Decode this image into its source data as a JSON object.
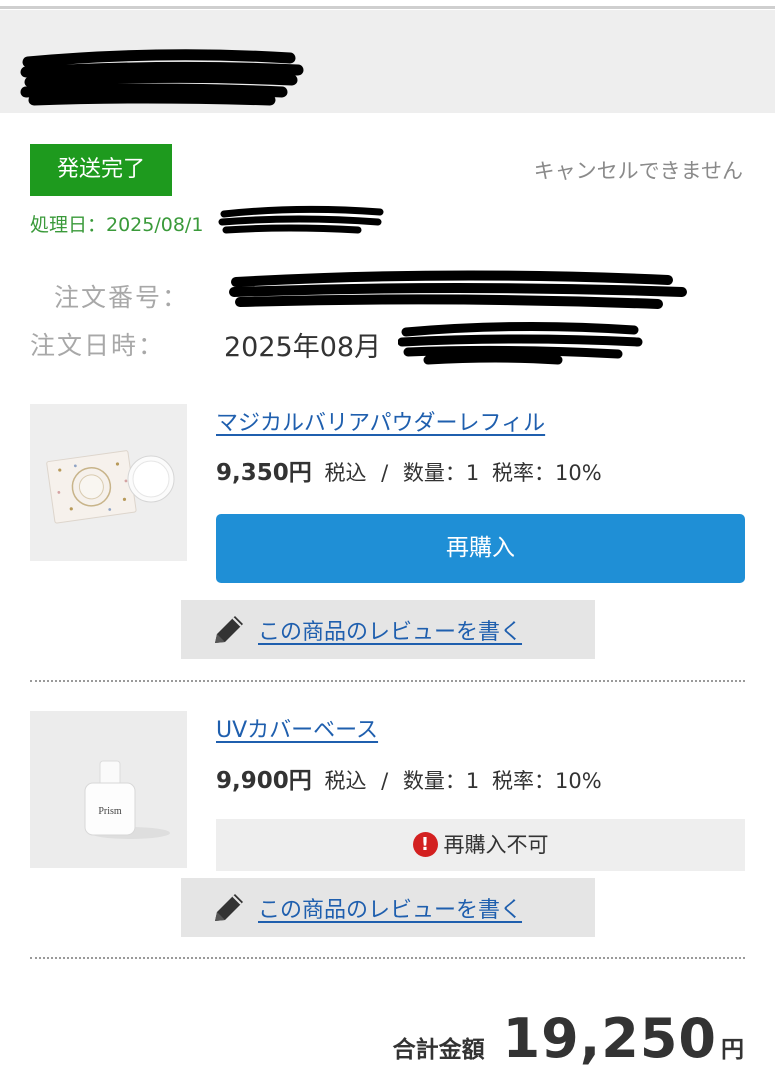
{
  "colors": {
    "status_green": "#1e9a1e",
    "link_blue": "#1f5fae",
    "primary_button": "#1f8fd6",
    "alert_red": "#d32020"
  },
  "order": {
    "status": "発送完了",
    "cancel_note": "キャンセルできません",
    "processed_prefix": "処理日：2025/08/1",
    "order_number_label": "注文番号：",
    "order_date_label": "注文日時：",
    "order_date_prefix": "2025年08月"
  },
  "items": [
    {
      "name": "マジカルバリアパウダーレフィル",
      "price": "9,350円",
      "tax_label": "税込",
      "separator": "/",
      "quantity": "数量：1",
      "tax_rate": "税率：10%",
      "image_icon": "powder-compact-photo",
      "action": "再購入",
      "review": "この商品のレビューを書く"
    },
    {
      "name": "UVカバーベース",
      "price": "9,900円",
      "tax_label": "税込",
      "separator": "/",
      "quantity": "数量：1",
      "tax_rate": "税率：10%",
      "image_icon": "bottle-photo",
      "bottle_text": "Prism",
      "action_disabled": "再購入不可",
      "alert_glyph": "!",
      "review": "この商品のレビューを書く"
    }
  ],
  "total": {
    "label": "合計金額",
    "value": "19,250",
    "unit": "円"
  }
}
